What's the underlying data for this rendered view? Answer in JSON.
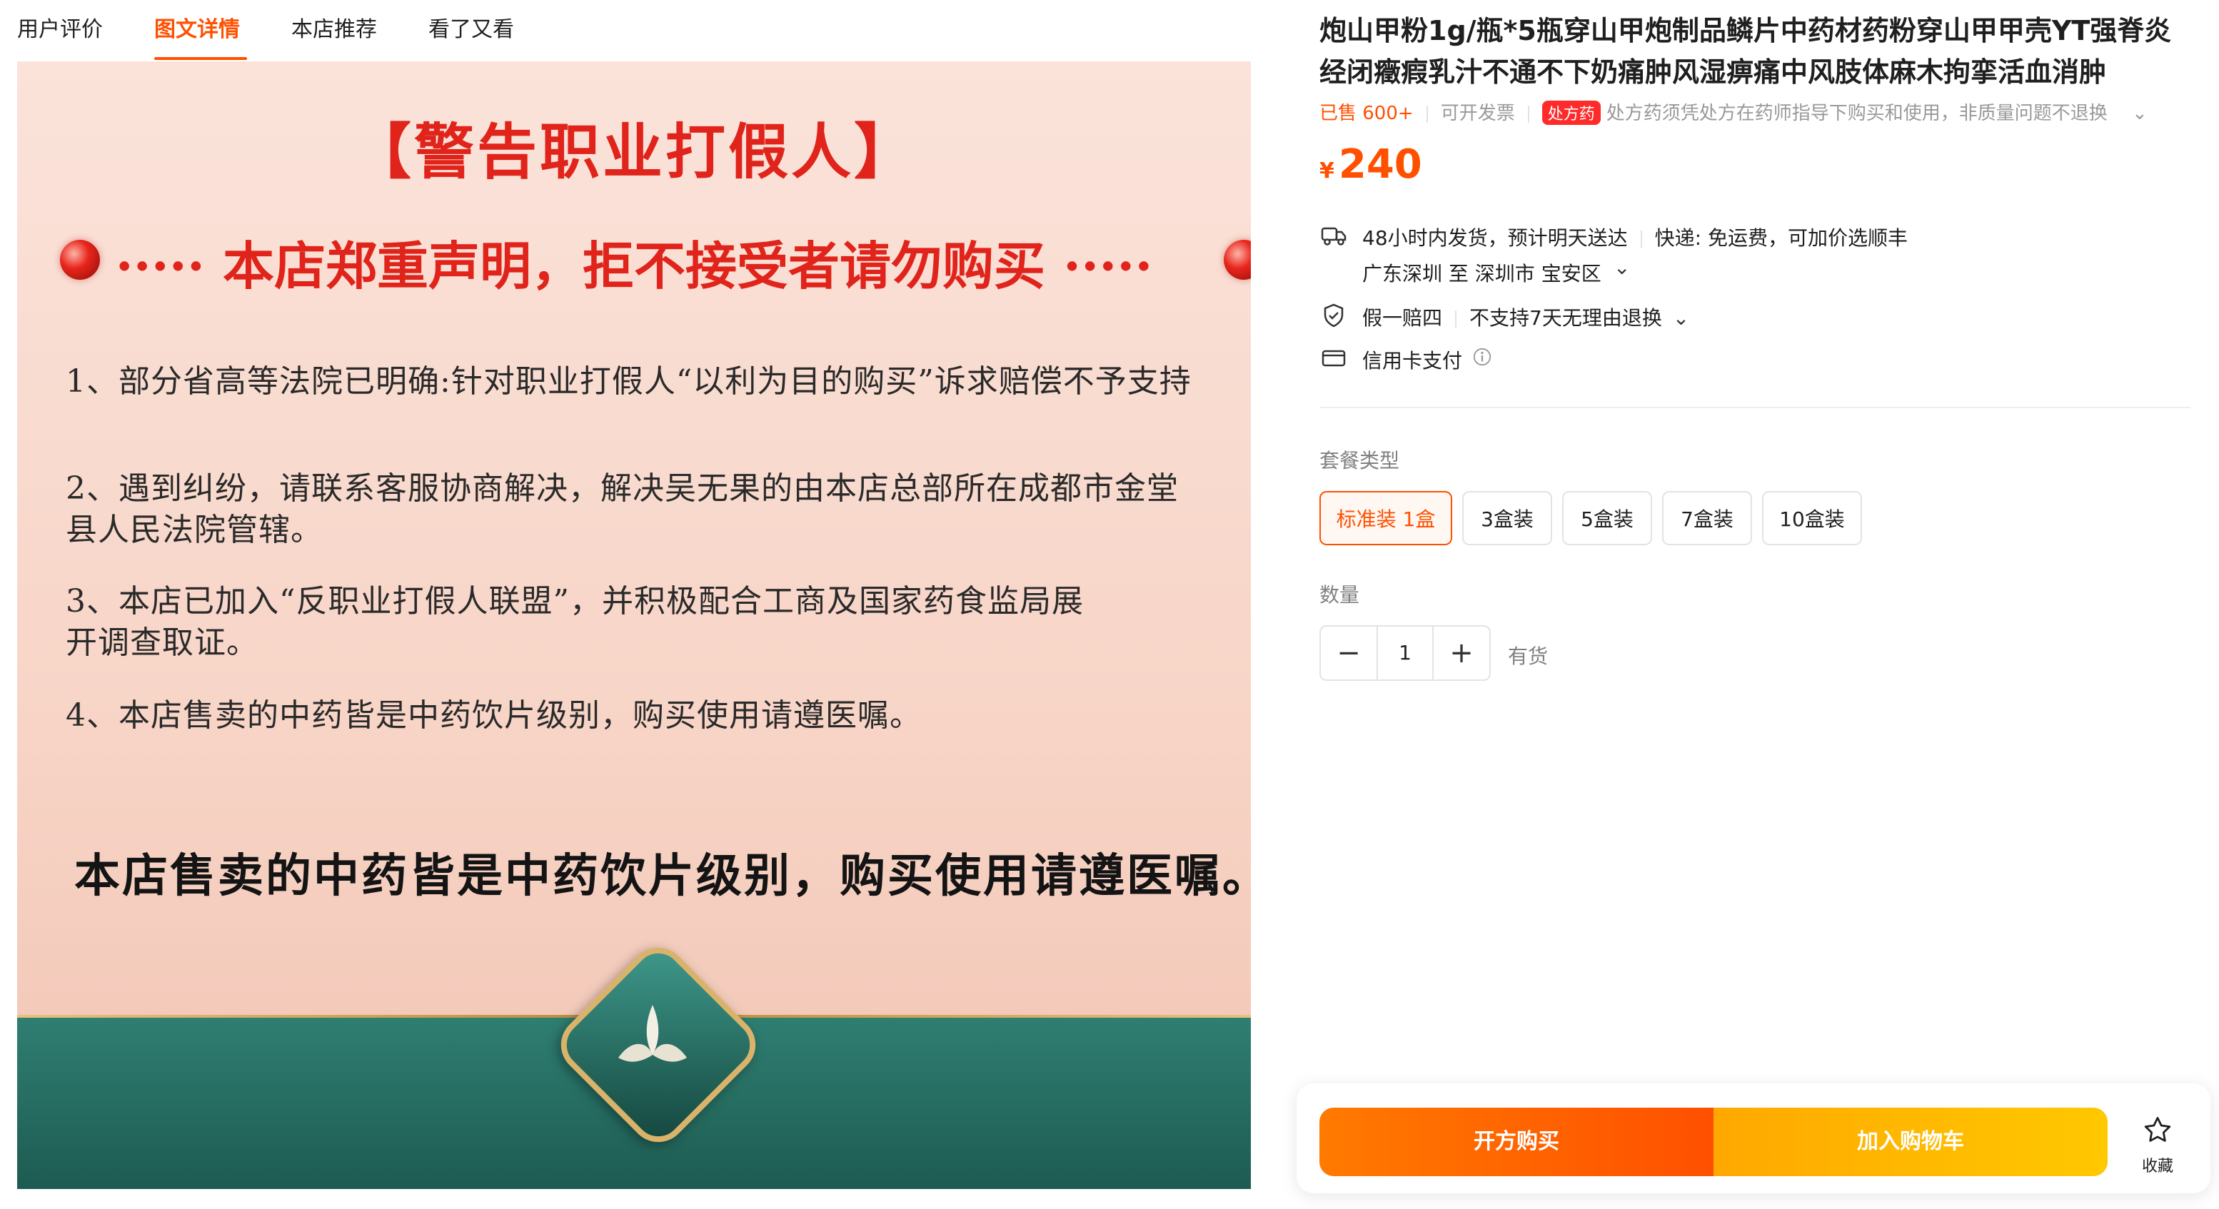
{
  "tabs": [
    "用户评价",
    "图文详情",
    "本店推荐",
    "看了又看"
  ],
  "active_tab": "图文详情",
  "detail_image": {
    "title": "【警告职业打假人】",
    "declaration": "····· 本店郑重声明，拒不接受者请勿购买 ·····",
    "rules": [
      "1、部分省高等法院已明确:针对职业打假人“以利为目的购买”诉求赔偿不予支持",
      "2、遇到纠纷，请联系客服协商解决，解决吴无果的由本店总部所在成都市金堂\n县人民法院管辖。",
      "3、本店已加入“反职业打假人联盟”，并积极配合工商及国家药食监局展\n开调查取证。",
      "4、本店售卖的中药皆是中药饮片级别，购买使用请遵医嘱。"
    ],
    "bottom_note": "本店售卖的中药皆是中药饮片级别，购买使用请遵医嘱。"
  },
  "product": {
    "title": "炮山甲粉1g/瓶*5瓶穿山甲炮制品鳞片中药材药粉穿山甲甲壳YT强脊炎经闭癥瘕乳汁不通不下奶痛肿风湿痹痛中风肢体麻木拘挛活血消肿",
    "sold": "已售 600+",
    "invoice": "可开发票",
    "rx_badge": "处方药",
    "rx_note": "处方药须凭处方在药师指导下购买和使用，非质量问题不退换",
    "currency": "¥",
    "price": "240"
  },
  "service": {
    "shipping": "48小时内发货，预计明天送达",
    "express": "快递: 免运费，可加价选顺丰",
    "route": "广东深圳 至 深圳市 宝安区",
    "guarantee": "假一赔四",
    "returns": "不支持7天无理由退换",
    "payment": "信用卡支付"
  },
  "options": {
    "label": "套餐类型",
    "items": [
      "标准装 1盒",
      "3盒装",
      "5盒装",
      "7盒装",
      "10盒装"
    ],
    "selected": "标准装 1盒"
  },
  "quantity": {
    "label": "数量",
    "value": "1",
    "minus": "−",
    "plus": "+",
    "stock": "有货"
  },
  "actions": {
    "buy": "开方购买",
    "cart": "加入购物车",
    "favorite": "收藏"
  },
  "colors": {
    "accent": "#ff5000",
    "cart": "#ffb400",
    "warning_red": "#e0241b",
    "teal": "#2f7e72"
  }
}
